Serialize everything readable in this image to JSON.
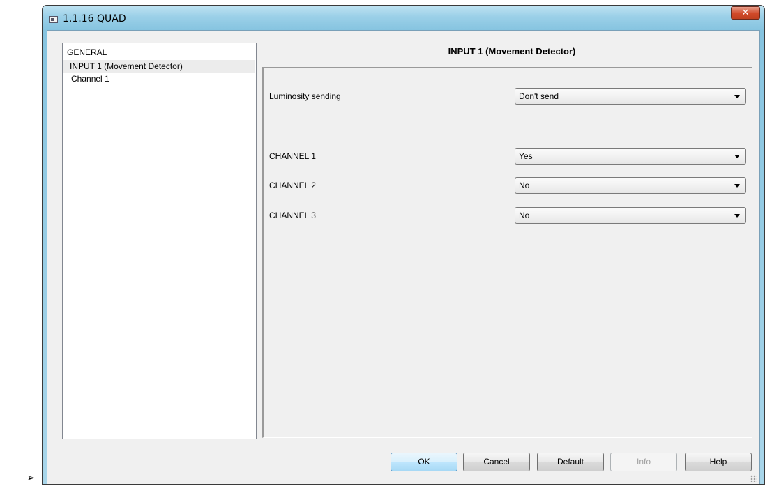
{
  "window": {
    "title": "1.1.16 QUAD",
    "close_symbol": "✕"
  },
  "tree": {
    "items": [
      {
        "label": "GENERAL"
      },
      {
        "label": "INPUT 1 (Movement Detector)"
      },
      {
        "label": "Channel 1"
      }
    ]
  },
  "panel": {
    "title": "INPUT 1 (Movement Detector)",
    "rows": [
      {
        "label": "Luminosity sending",
        "value": "Don't send"
      },
      {
        "label": "CHANNEL 1",
        "value": "Yes"
      },
      {
        "label": "CHANNEL 2",
        "value": "No"
      },
      {
        "label": "CHANNEL 3",
        "value": "No"
      }
    ]
  },
  "buttons": {
    "ok": "OK",
    "cancel": "Cancel",
    "default": "Default",
    "info": "Info",
    "help": "Help"
  },
  "page": {
    "bullet": "➢"
  },
  "colors": {
    "titlebar": "#9bd0e8",
    "close_button": "#d04a2a",
    "dialog_bg": "#f0f0f0",
    "selection": "#ececec"
  }
}
